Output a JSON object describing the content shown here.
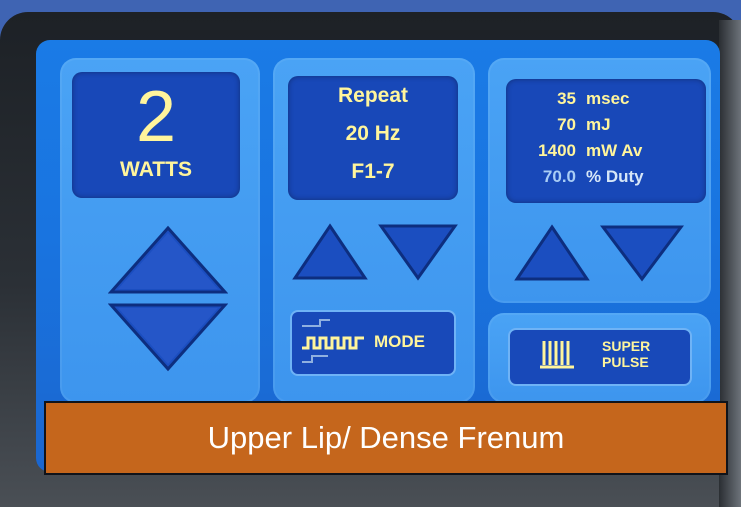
{
  "power": {
    "value": "2",
    "unit": "WATTS"
  },
  "repeat": {
    "mode": "Repeat",
    "frequency": "20 Hz",
    "preset": "F1-7"
  },
  "stats": [
    {
      "value": "35",
      "label": "msec"
    },
    {
      "value": "70",
      "label": "mJ"
    },
    {
      "value": "1400",
      "label": "mW Av"
    },
    {
      "value": "70.0",
      "label": "% Duty"
    }
  ],
  "buttons": {
    "mode_label": "MODE",
    "super_pulse_line1": "SUPER",
    "super_pulse_line2": "PULSE"
  },
  "caption": "Upper Lip/ Dense Frenum",
  "colors": {
    "screen": "#1a74e0",
    "panel": "#4aa3f5",
    "display": "#1848b8",
    "text": "#fff59c",
    "caption_bg": "#c5661c"
  }
}
